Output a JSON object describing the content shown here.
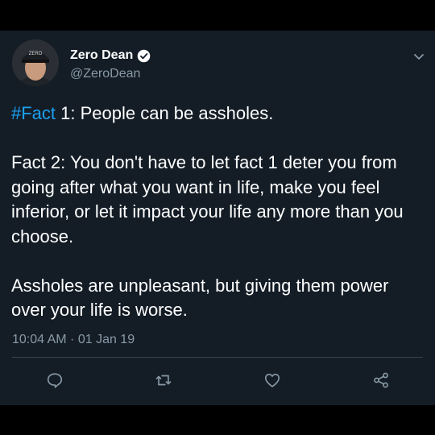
{
  "tweet": {
    "author": {
      "display_name": "Zero Dean",
      "handle": "@ZeroDean",
      "verified": true,
      "avatar_cap_text": "ZERO"
    },
    "text": {
      "hashtag": "#Fact",
      "line1_rest": " 1: People can be assholes.",
      "para2": "Fact 2: You don't have to let fact 1 deter you from going after what you want in life, make you feel inferior, or let it impact your life any more than you choose.",
      "para3": "Assholes are unpleasant, but giving them power over your life is worse."
    },
    "timestamp": "10:04 AM · 01 Jan 19",
    "actions": [
      "reply-icon",
      "retweet-icon",
      "like-icon",
      "share-icon"
    ]
  },
  "colors": {
    "background": "#141d26",
    "text": "#ffffff",
    "secondary_text": "#8899a6",
    "link": "#1da1f2",
    "divider": "#38444d"
  }
}
